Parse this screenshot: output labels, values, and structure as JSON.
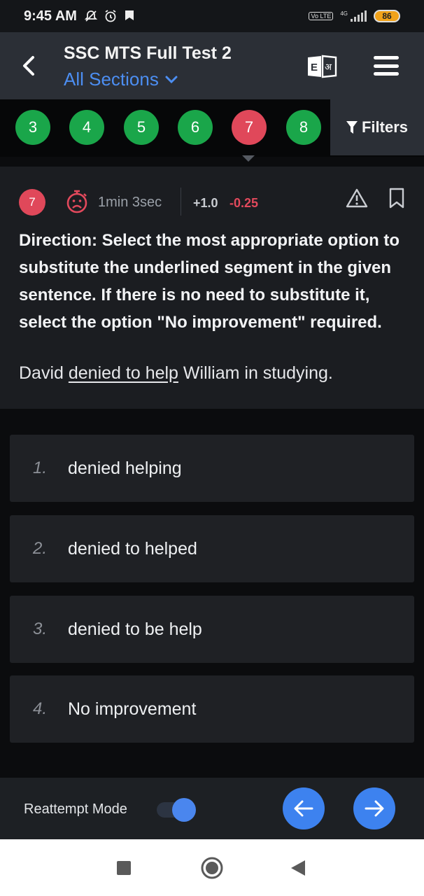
{
  "status_bar": {
    "time": "9:45 AM",
    "icons": [
      "notifications-off-icon",
      "alarm-icon",
      "app-notification-icon"
    ],
    "network": "4G",
    "volte": "Vo LTE",
    "battery": "86"
  },
  "app_bar": {
    "title": "SSC MTS Full Test 2",
    "section_selector": "All Sections",
    "language_toggle": [
      "E",
      "अ"
    ]
  },
  "question_palette": {
    "items": [
      {
        "number": "3",
        "status": "answered",
        "color": "#1aa64a"
      },
      {
        "number": "4",
        "status": "answered",
        "color": "#1aa64a"
      },
      {
        "number": "5",
        "status": "answered",
        "color": "#1aa64a"
      },
      {
        "number": "6",
        "status": "answered",
        "color": "#1aa64a"
      },
      {
        "number": "7",
        "status": "current-incorrect",
        "color": "#e0485a"
      },
      {
        "number": "8",
        "status": "answered",
        "color": "#1aa64a"
      }
    ],
    "filters_label": "Filters"
  },
  "question": {
    "number": "7",
    "time_taken": "1min 3sec",
    "positive_marks": "+1.0",
    "negative_marks": "-0.25",
    "direction": "Direction: Select the most appropriate option to substitute the underlined segment in the given sentence. If there is no need to substitute it, select the option \"No improvement\" required.",
    "sentence_before": "David ",
    "sentence_underlined": "denied to help",
    "sentence_after": " William in studying."
  },
  "options": [
    {
      "index": "1.",
      "text": "denied helping"
    },
    {
      "index": "2.",
      "text": "denied to helped"
    },
    {
      "index": "3.",
      "text": "denied to be help"
    },
    {
      "index": "4.",
      "text": "No improvement"
    }
  ],
  "bottom_bar": {
    "reattempt_label": "Reattempt Mode",
    "reattempt_enabled": true
  },
  "colors": {
    "accent": "#3d82ef",
    "correct": "#1aa64a",
    "incorrect": "#e0485a",
    "link": "#4c8ef2"
  }
}
